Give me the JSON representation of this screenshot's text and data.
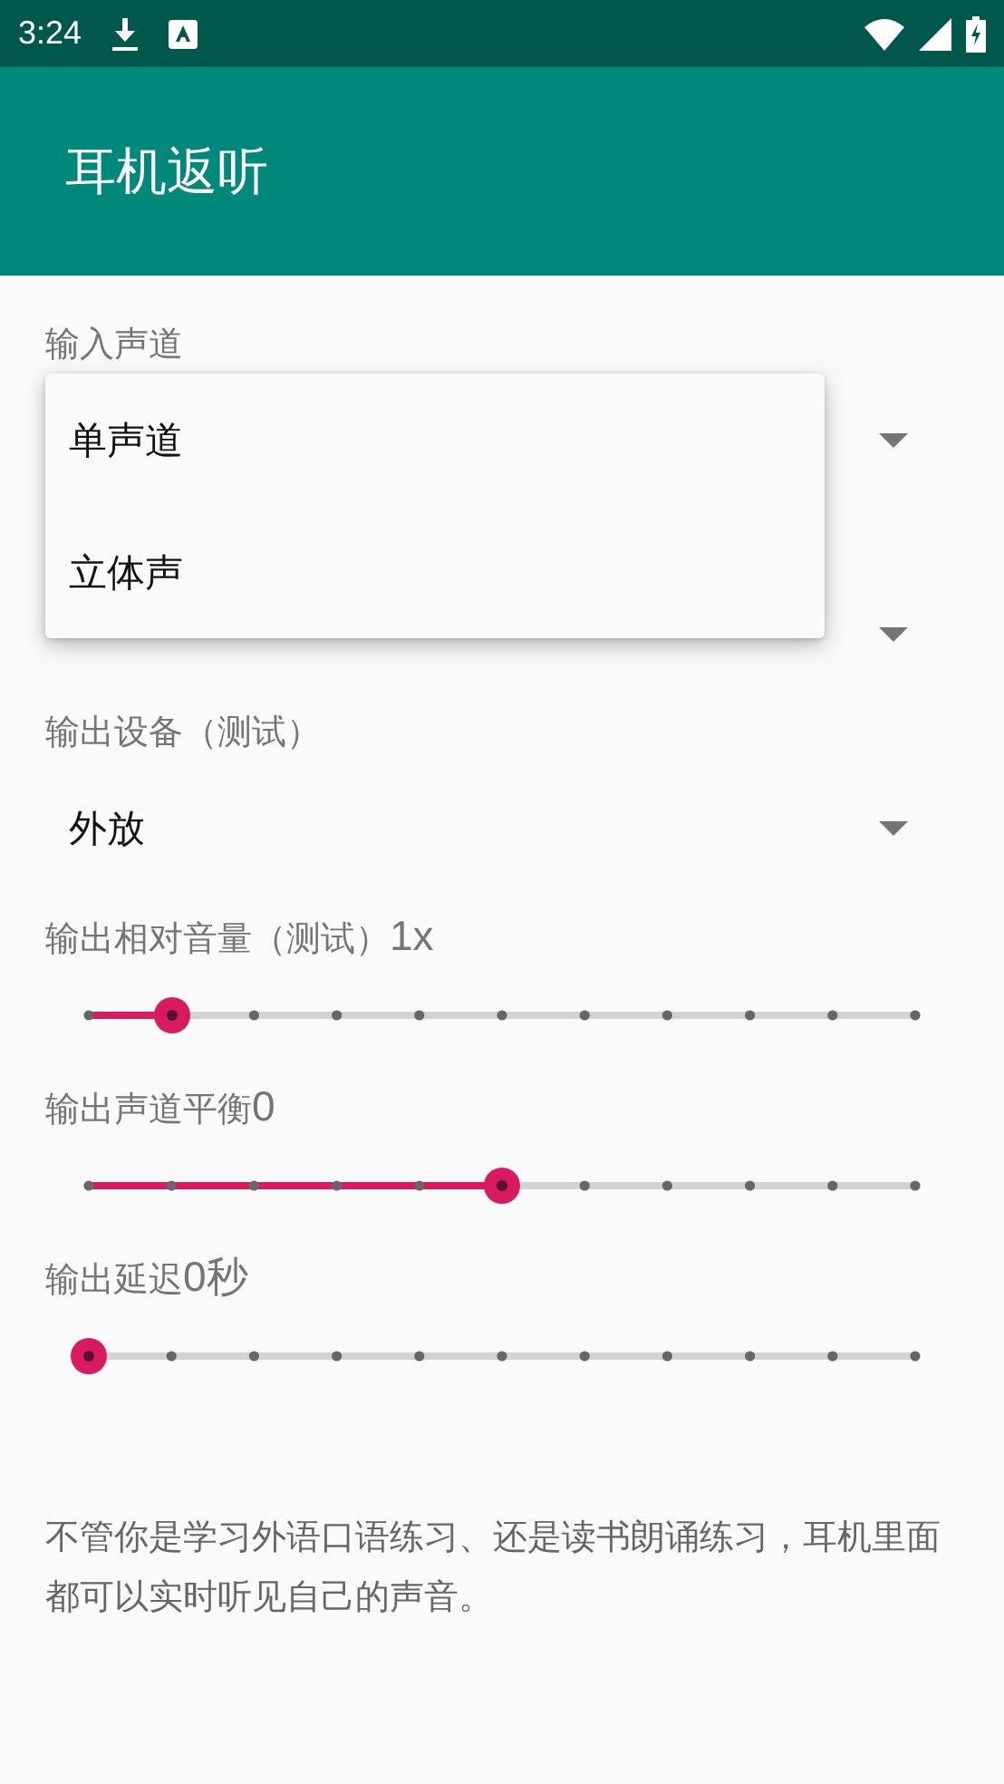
{
  "status_bar": {
    "time": "3:24"
  },
  "app_bar": {
    "title": "耳机返听"
  },
  "settings": [
    {
      "kind": "spinner",
      "label": "输入声道"
    },
    {
      "kind": "spinner"
    },
    {
      "kind": "spinner",
      "label": "输出设备（测试）",
      "value": "外放"
    },
    {
      "kind": "slider",
      "label": "输出相对音量（测试）",
      "reading": "1x",
      "level": 0.1
    },
    {
      "kind": "slider",
      "label": "输出声道平衡",
      "reading": "0",
      "level": 0.5
    },
    {
      "kind": "slider",
      "label": "输出延迟",
      "reading": "0秒",
      "level": 0
    }
  ],
  "dropdown_menu": {
    "items": [
      {
        "label": "单声道"
      },
      {
        "label": "立体声"
      }
    ]
  },
  "description": "不管你是学习外语口语练习、还是读书朗诵练习，耳机里面都可以实时听见自己的声音。"
}
